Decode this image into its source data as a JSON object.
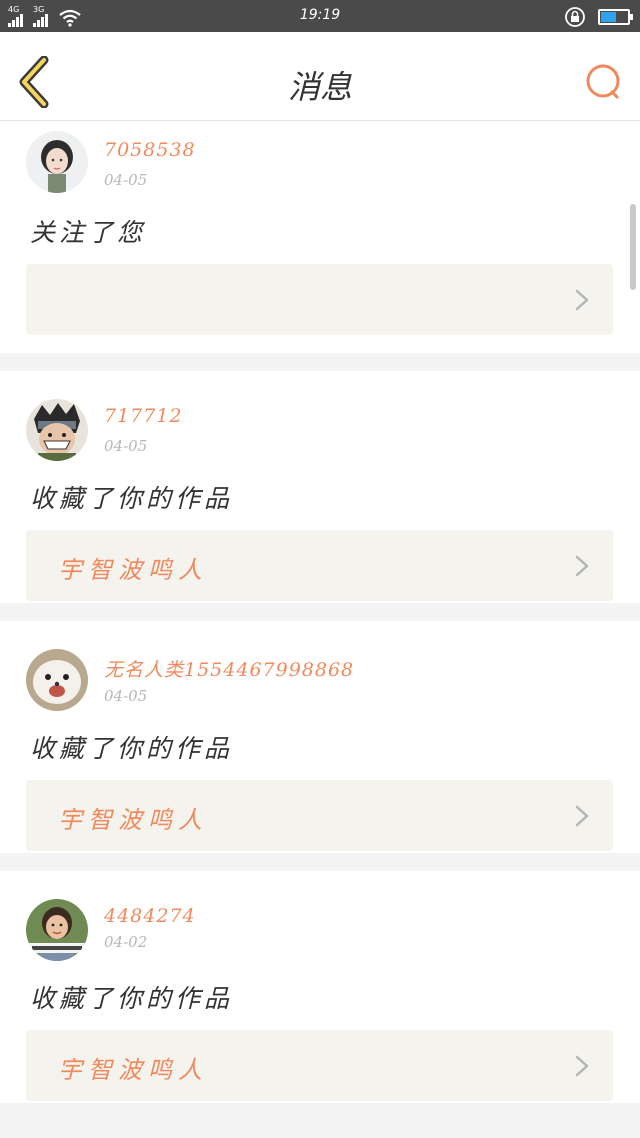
{
  "status_bar": {
    "net1": "4G",
    "net2": "3G",
    "time": "19:19",
    "battery_level": 0.55,
    "battery_color": "#2ea4f0"
  },
  "header": {
    "title": "消息",
    "back_icon": "chevron-left-icon",
    "search_icon": "search-icon",
    "accent_color": "#f08a5d"
  },
  "messages": [
    {
      "username": "7058538",
      "date": "04-05",
      "action": "关注了您",
      "work_title": ""
    },
    {
      "username": "717712",
      "date": "04-05",
      "action": "收藏了你的作品",
      "work_title": "宇智波鸣人"
    },
    {
      "username": "无名人类1554467998868",
      "date": "04-05",
      "action": "收藏了你的作品",
      "work_title": "宇智波鸣人"
    },
    {
      "username": "4484274",
      "date": "04-02",
      "action": "收藏了你的作品",
      "work_title": "宇智波鸣人"
    }
  ]
}
